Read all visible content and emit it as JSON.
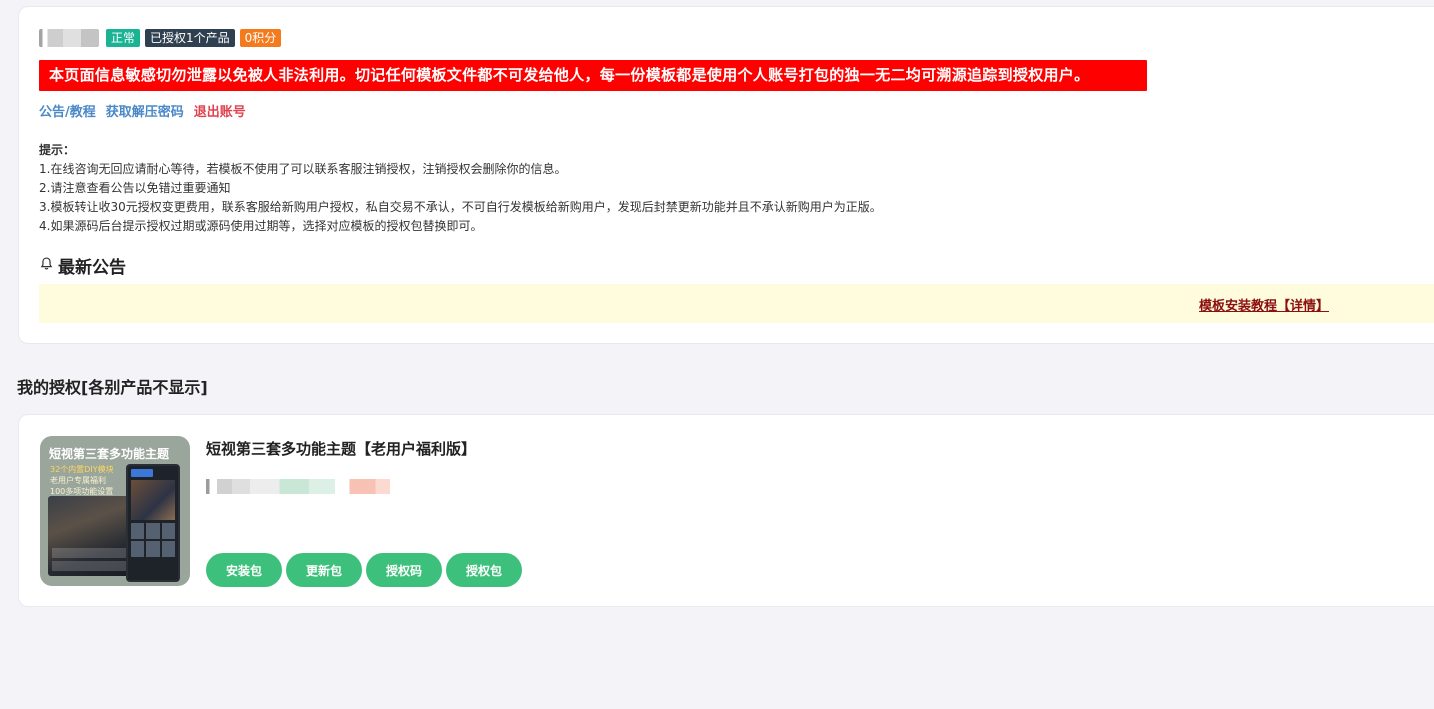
{
  "user": {
    "badges": [
      "正常",
      "已授权1个产品",
      "0积分"
    ]
  },
  "warning_text": "本页面信息敏感切勿泄露以免被人非法利用。切记任何模板文件都不可发给他人，每一份模板都是使用个人账号打包的独一无二均可溯源追踪到授权用户。",
  "links": {
    "announcement": "公告/教程",
    "unzip_password": "获取解压密码",
    "logout": "退出账号"
  },
  "tips": {
    "title": "提示：",
    "items": [
      "1.在线咨询无回应请耐心等待，若模板不使用了可以联系客服注销授权，注销授权会删除你的信息。",
      "2.请注意查看公告以免错过重要通知",
      "3.模板转让收30元授权变更费用，联系客服给新购用户授权，私自交易不承认，不可自行发模板给新购用户，发现后封禁更新功能并且不承认新购用户为正版。",
      "4.如果源码后台提示授权过期或源码使用过期等，选择对应模板的授权包替换即可。"
    ]
  },
  "announcement": {
    "heading": "最新公告",
    "link_text": "模板安装教程【详情】"
  },
  "section_title": "我的授权[各别产品不显示]",
  "license": {
    "thumbnail": {
      "title": "短视第三套多功能主题",
      "lines": [
        "32个内置DIY模块",
        "老用户专属福利",
        "100多项功能设置"
      ]
    },
    "product_name": "短视第三套多功能主题【老用户福利版】",
    "buttons": [
      "安装包",
      "更新包",
      "授权码",
      "授权包"
    ]
  },
  "colors": {
    "warning_bg": "#ff0000",
    "button_green": "#3cc07b",
    "badge_green": "#1ab394",
    "badge_navy": "#2f4050",
    "badge_orange": "#f37b1d",
    "announcement_bg": "#fefcdc"
  },
  "icons": {
    "announcement": "bell-icon"
  }
}
